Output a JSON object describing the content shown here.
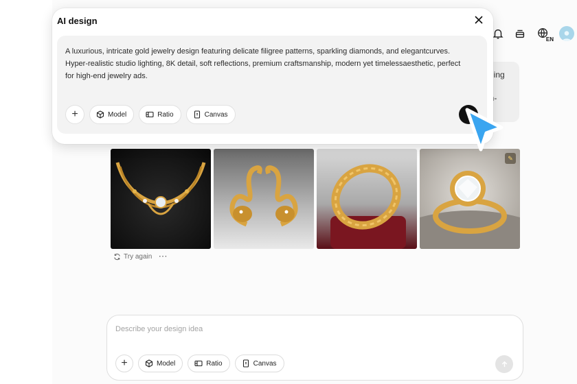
{
  "dialog": {
    "title": "AI design",
    "prompt": "A luxurious, intricate gold jewelry design featuring delicate filigree patterns, sparkling diamonds, and elegantcurves. Hyper-realistic studio lighting, 8K detail, soft reflections, premium craftsmanship, modern yet timelessaesthetic, perfect for high-end jewelry ads.",
    "chips": {
      "model": "Model",
      "ratio": "Ratio",
      "canvas": "Canvas"
    }
  },
  "header": {
    "language": "EN"
  },
  "previous_message": {
    "line1": "rkling",
    "line2": "gh-"
  },
  "results": {
    "images": [
      "gold-necklace-image",
      "gold-swan-earrings-image",
      "gold-filigree-ring-image",
      "diamond-ring-in-box-image"
    ],
    "actions": {
      "try_again": "Try again",
      "more": "···"
    }
  },
  "composer": {
    "placeholder": "Describe your design idea",
    "chips": {
      "model": "Model",
      "ratio": "Ratio",
      "canvas": "Canvas"
    }
  },
  "colors": {
    "accent_cursor": "#3aa5f0",
    "gold": "#d9a441",
    "send_inactive": "#e4e4e4"
  }
}
